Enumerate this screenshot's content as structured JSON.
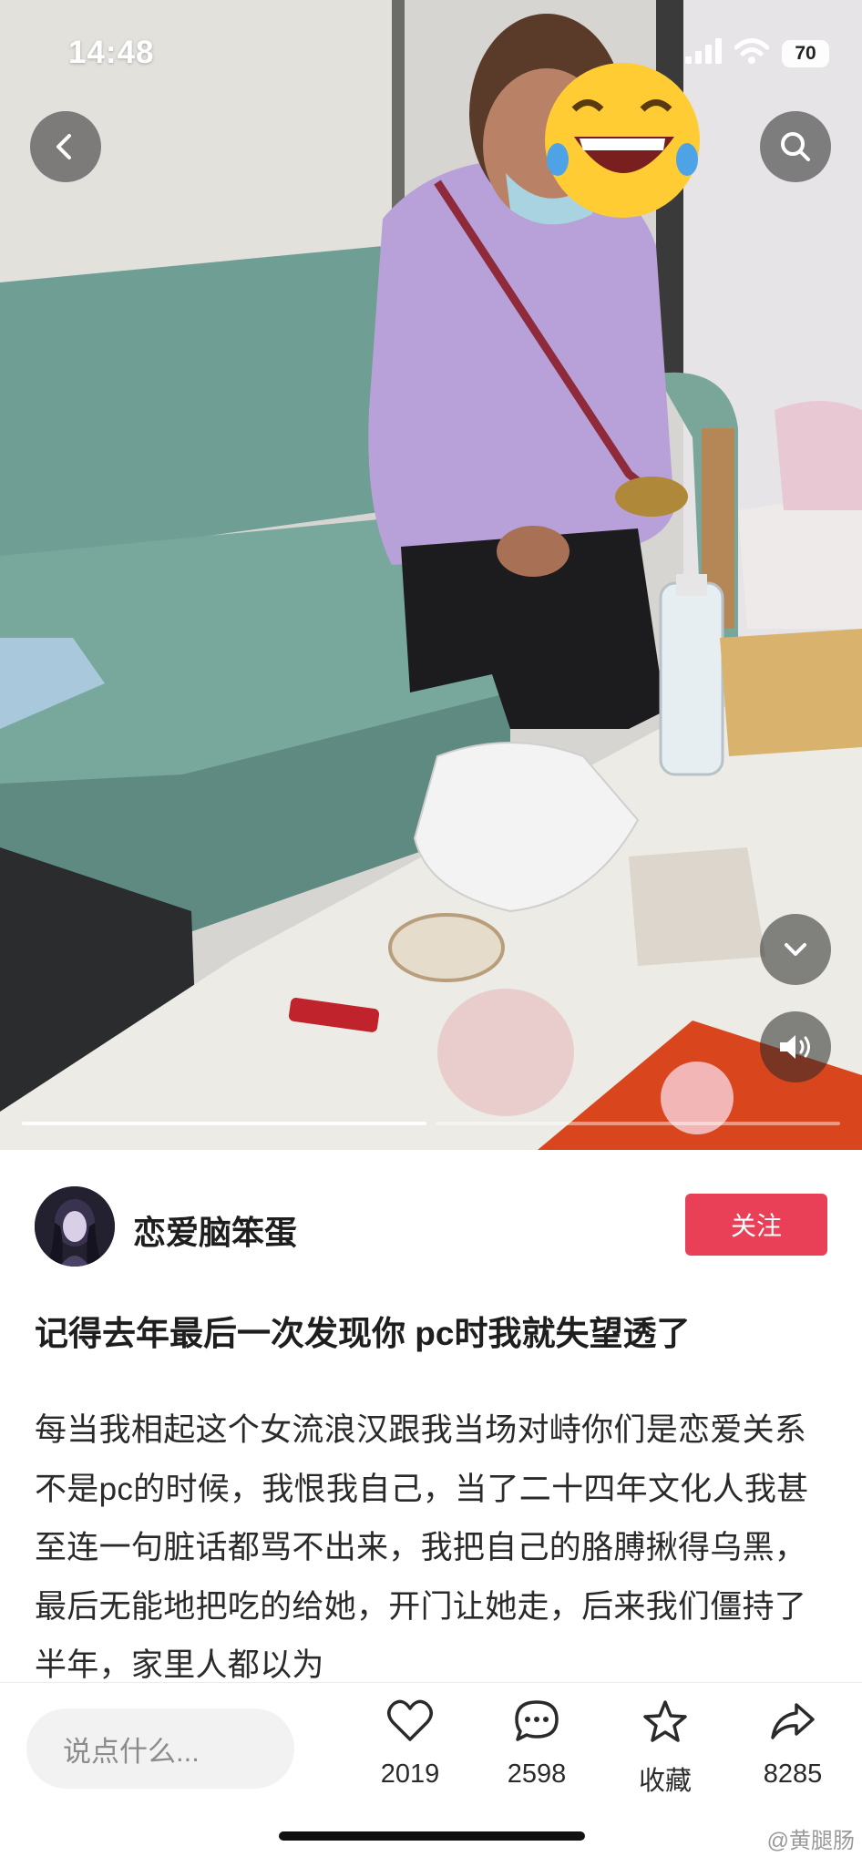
{
  "status_bar": {
    "time": "14:48",
    "battery": "70",
    "signal_icon": "cellular-signal-icon",
    "wifi_icon": "wifi-icon"
  },
  "media": {
    "back_icon": "chevron-left-icon",
    "search_icon": "search-icon",
    "collapse_icon": "chevron-down-icon",
    "sound_icon": "speaker-icon",
    "progress_segments": 2,
    "active_segment": 1
  },
  "author": {
    "name": "恋爱脑笨蛋",
    "follow_label": "关注"
  },
  "post": {
    "title": "记得去年最后一次发现你 pc时我就失望透了",
    "body": "每当我相起这个女流浪汉跟我当场对峙你们是恋爱关系不是pc的时候，我恨我自己，当了二十四年文化人我甚至连一句脏话都骂不出来，我把自己的胳膊揪得乌黑，最后无能地把吃的给她，开门让她走，后来我们僵持了半年，家里人都以为"
  },
  "bottom_bar": {
    "comment_placeholder": "说点什么...",
    "like_count": "2019",
    "comment_count": "2598",
    "favorite_label": "收藏",
    "share_count": "8285"
  },
  "watermark": "@黄腿肠",
  "colors": {
    "accent": "#e94058",
    "text": "#1e1e1e",
    "input_bg": "#f2f2f2"
  }
}
